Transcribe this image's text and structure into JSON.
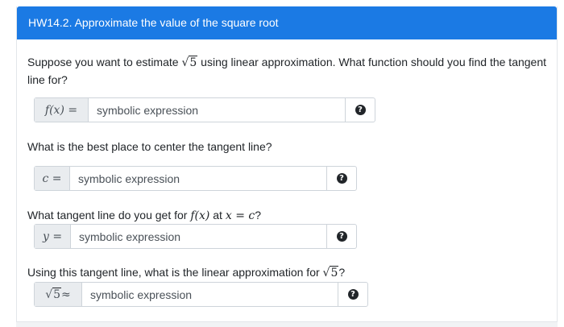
{
  "header": {
    "title": "HW14.2. Approximate the value of the square root"
  },
  "q1": {
    "text_before": "Suppose you want to estimate ",
    "radicand": "5",
    "text_after": " using linear approximation. What function should you find the tangent",
    "text_line2": "line for?",
    "addon": "f(x) =",
    "placeholder": "symbolic expression"
  },
  "q2": {
    "text": "What is the best place to center the tangent line?",
    "addon": "c =",
    "placeholder": "symbolic expression"
  },
  "q3": {
    "text_before": "What tangent line do you get for ",
    "fx": "f(x)",
    "text_mid": " at ",
    "cond": "x = c",
    "text_after": "?",
    "addon": "y =",
    "placeholder": "symbolic expression"
  },
  "q4": {
    "text_before": "Using this tangent line, what is the linear approximation for ",
    "radicand": "5",
    "text_after": "?",
    "addon_radicand": "5",
    "addon_approx": " ≈",
    "placeholder": "symbolic expression"
  },
  "icons": {
    "help": "help-circle-icon",
    "help_glyph": "?"
  },
  "colors": {
    "header_bg": "#1b7ae4",
    "addon_bg": "#e9ecef",
    "border": "#ced4da"
  }
}
